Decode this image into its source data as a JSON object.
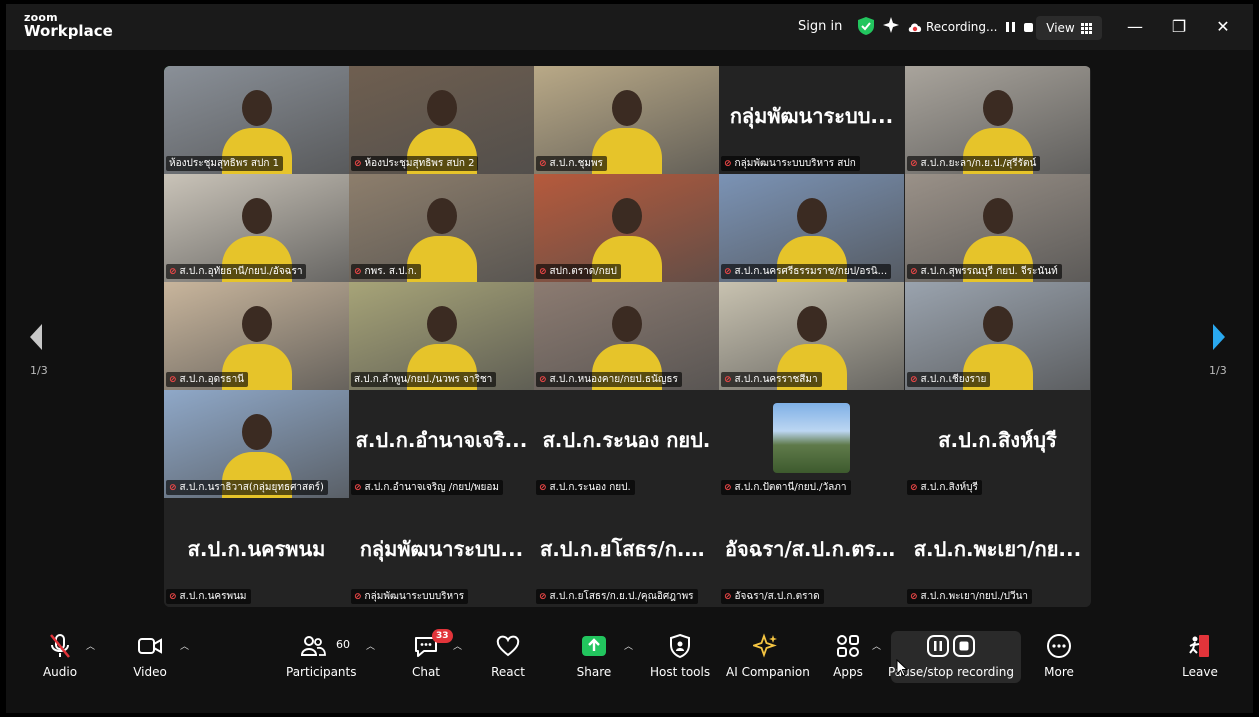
{
  "app": {
    "logo_line1": "zoom",
    "logo_line2": "Workplace"
  },
  "titlebar": {
    "sign_in": "Sign in",
    "recording_label": "Recording...",
    "view_label": "View",
    "minimize": "—",
    "restore": "❐",
    "close": "✕"
  },
  "gallery": {
    "page_left": "1/3",
    "page_right": "1/3",
    "tiles": [
      {
        "name": "ห้องประชุมสุทธิพร สปก 1",
        "big": "",
        "bg": "#8a9098",
        "muted": false,
        "active": true
      },
      {
        "name": "ห้องประชุมสุทธิพร สปก 2",
        "big": "",
        "bg": "#6f5f50",
        "muted": true
      },
      {
        "name": "ส.ป.ก.ชุมพร",
        "big": "",
        "bg": "#b9a987",
        "muted": true
      },
      {
        "name": "กลุ่มพัฒนาระบบบริหาร สปก",
        "big": "กลุ่มพัฒนาระบบ...",
        "bg": "",
        "muted": true
      },
      {
        "name": "ส.ป.ก.ยะลา/ก.ย.ป./สุรีรัตน์",
        "big": "",
        "bg": "#a9a49c",
        "muted": true
      },
      {
        "name": "ส.ป.ก.อุทัยธานี/กยป./อัจฉรา",
        "big": "",
        "bg": "#c9c3b8",
        "muted": true
      },
      {
        "name": "กพร. ส.ป.ก.",
        "big": "",
        "bg": "#8d7e6c",
        "muted": true
      },
      {
        "name": "สปก.ตราด/กยป",
        "big": "",
        "bg": "#b65a3c",
        "muted": true
      },
      {
        "name": "ส.ป.ก.นครศรีธรรมราช/กยป/อรนิ...",
        "big": "",
        "bg": "#7b93b5",
        "muted": true
      },
      {
        "name": "ส.ป.ก.สุพรรณบุรี กยป. จีระนันท์",
        "big": "",
        "bg": "#9a9188",
        "muted": true
      },
      {
        "name": "ส.ป.ก.อุดรธานี",
        "big": "",
        "bg": "#c8b59c",
        "muted": true
      },
      {
        "name": "ส.ป.ก.ลำพูน/กยป./นวพร จาริชา",
        "big": "",
        "bg": "#a7a478",
        "muted": false
      },
      {
        "name": "ส.ป.ก.หนองคาย/กยป.ธนัญธร",
        "big": "",
        "bg": "#8c7b71",
        "muted": true
      },
      {
        "name": "ส.ป.ก.นครราชสีมา",
        "big": "",
        "bg": "#c8c2b0",
        "muted": true
      },
      {
        "name": "ส.ป.ก.เชียงราย",
        "big": "",
        "bg": "#9aa3ae",
        "muted": true
      },
      {
        "name": "ส.ป.ก.นราธิวาส(กลุ่มยุทธศาสตร์)",
        "big": "",
        "bg": "#8fa8c8",
        "muted": true
      },
      {
        "name": "ส.ป.ก.อำนาจเจริญ /กยป/พยอม",
        "big": "ส.ป.ก.อำนาจเจริ...",
        "bg": "",
        "muted": true
      },
      {
        "name": "ส.ป.ก.ระนอง กยป.",
        "big": "ส.ป.ก.ระนอง กยป.",
        "bg": "",
        "muted": true
      },
      {
        "name": "ส.ป.ก.ปัตตานี/กยป./วัลภา",
        "big": "",
        "bg": "",
        "avatar": true,
        "muted": true
      },
      {
        "name": "ส.ป.ก.สิงห์บุรี",
        "big": "ส.ป.ก.สิงห์บุรี",
        "bg": "",
        "muted": true
      },
      {
        "name": "ส.ป.ก.นครพนม",
        "big": "ส.ป.ก.นครพนม",
        "bg": "",
        "muted": true
      },
      {
        "name": "กลุ่มพัฒนาระบบบริหาร",
        "big": "กลุ่มพัฒนาระบบ...",
        "bg": "",
        "muted": true
      },
      {
        "name": "ส.ป.ก.ยโสธร/ก.ย.ป./คุณอิศฎาพร",
        "big": "ส.ป.ก.ยโสธร/ก.ย...",
        "bg": "",
        "muted": true
      },
      {
        "name": "อัจฉรา/ส.ป.ก.ตราด",
        "big": "อัจฉรา/ส.ป.ก.ตราด",
        "bg": "",
        "muted": true
      },
      {
        "name": "ส.ป.ก.พะเยา/กยป./ปวีนา",
        "big": "ส.ป.ก.พะเยา/กย...",
        "bg": "",
        "muted": true
      }
    ]
  },
  "toolbar": {
    "audio": "Audio",
    "video": "Video",
    "participants": "Participants",
    "participants_count": "60",
    "chat": "Chat",
    "chat_badge": "33",
    "react": "React",
    "share": "Share",
    "host_tools": "Host tools",
    "ai_companion": "AI Companion",
    "apps": "Apps",
    "recording": "Pause/stop recording",
    "more": "More",
    "leave": "Leave"
  },
  "colors": {
    "active_speaker": "#3ec96b",
    "share_green": "#22c55e",
    "muted_red": "#f04848",
    "accent_blue": "#2aa9f0"
  }
}
